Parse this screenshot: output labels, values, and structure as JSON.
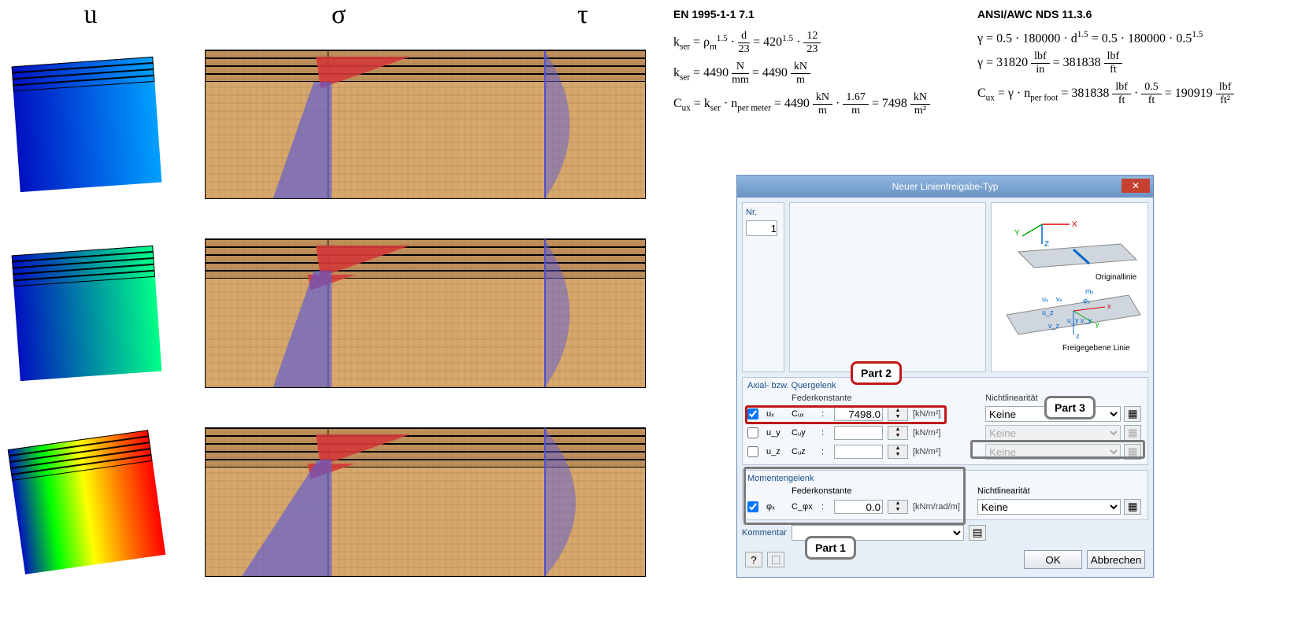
{
  "columns": {
    "u": "u",
    "sigma": "σ",
    "tau": "τ"
  },
  "formulas": {
    "left_title": "EN 1995-1-1 7.1",
    "left_lines": [
      "k_ser = ρ_m^1.5 · d/23 = 420^1.5 · 12/23",
      "k_ser = 4490 N/mm = 4490 kN/m",
      "C_ux = k_ser · n_per meter = 4490 kN/m · 1.67/m = 7498 kN/m²"
    ],
    "right_title": "ANSI/AWC NDS 11.3.6",
    "right_lines": [
      "γ = 0.5 · 180000 · d^1.5 = 0.5 · 180000 · 0.5^1.5",
      "γ = 31820 lbf/in = 381838 lbf/ft",
      "C_ux = γ · n_per foot = 381838 lbf/ft · 0.5/ft = 190919 lbf/ft²"
    ]
  },
  "dialog": {
    "title": "Neuer Linienfreigabe-Typ",
    "close": "✕",
    "nr_label": "Nr.",
    "nr_value": "1",
    "coord_labels": {
      "original": "Originallinie",
      "released": "Freigegebene Linie"
    },
    "axial_title": "Axial- bzw. Quergelenk",
    "spring_header": "Federkonstante",
    "nonlin_header": "Nichtlinearität",
    "rows": [
      {
        "name": "ux",
        "label": "uₓ",
        "cname": "Cᵤₓ",
        "value": "7498.0",
        "unit": "[kN/m²]",
        "checked": true,
        "nl": "Keine",
        "nl_enabled": true
      },
      {
        "name": "uy",
        "label": "u_y",
        "cname": "Cᵤy",
        "value": "",
        "unit": "[kN/m²]",
        "checked": false,
        "nl": "Keine",
        "nl_enabled": false
      },
      {
        "name": "uz",
        "label": "u_z",
        "cname": "Cᵤz",
        "value": "",
        "unit": "[kN/m²]",
        "checked": false,
        "nl": "Keine",
        "nl_enabled": false
      }
    ],
    "moment_title": "Momentengelenk",
    "moment_row": {
      "name": "phix",
      "label": "φₓ",
      "cname": "C_φx",
      "value": "0.0",
      "unit": "[kNm/rad/m]",
      "checked": true,
      "nl": "Keine"
    },
    "comment_label": "Kommentar",
    "comment_value": "",
    "ok": "OK",
    "cancel": "Abbrechen"
  },
  "callouts": {
    "part1": "Part 1",
    "part2": "Part 2",
    "part3": "Part 3"
  }
}
